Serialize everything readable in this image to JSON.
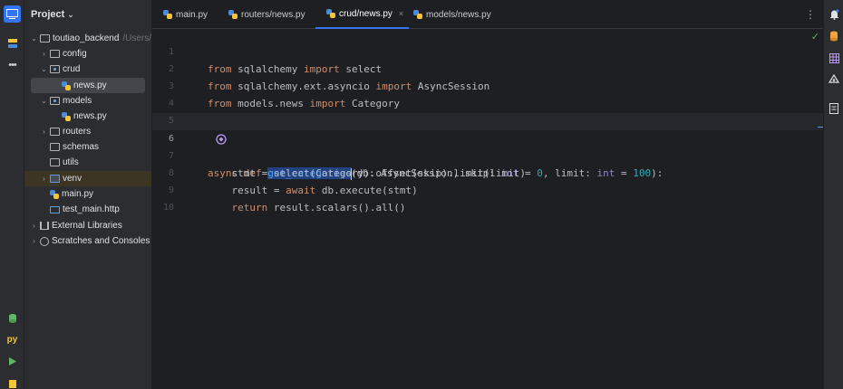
{
  "project_panel": {
    "title": "Project",
    "tree": [
      {
        "label": "toutiao_backend",
        "path": "/Users/d"
      },
      {
        "label": "config"
      },
      {
        "label": "crud"
      },
      {
        "label": "news.py"
      },
      {
        "label": "models"
      },
      {
        "label": "news.py"
      },
      {
        "label": "routers"
      },
      {
        "label": "schemas"
      },
      {
        "label": "utils"
      },
      {
        "label": "venv"
      },
      {
        "label": "main.py"
      },
      {
        "label": "test_main.http"
      },
      {
        "label": "External Libraries"
      },
      {
        "label": "Scratches and Consoles"
      }
    ]
  },
  "tabs": [
    {
      "label": "main.py"
    },
    {
      "label": "routers/news.py"
    },
    {
      "label": "crud/news.py",
      "close": "×"
    },
    {
      "label": "models/news.py"
    }
  ],
  "editor": {
    "line_numbers": [
      "1",
      "2",
      "3",
      "4",
      "5",
      "6",
      "7",
      "8",
      "9",
      "10"
    ],
    "code": {
      "l1": {
        "k1": "from",
        "t1": " sqlalchemy ",
        "k2": "import",
        "t2": " select"
      },
      "l2": {
        "k1": "from",
        "t1": " sqlalchemy.ext.asyncio ",
        "k2": "import",
        "t2": " AsyncSession"
      },
      "l3": {
        "k1": "from",
        "t1": " models.news ",
        "k2": "import",
        "t2": " Category"
      },
      "l6": {
        "k1": "async",
        "k2": " def ",
        "fn": "get_categories",
        "t1": "(db: AsyncSession, skip: ",
        "b1": "int",
        "t2": " = ",
        "n1": "0",
        "t3": ", limit: ",
        "b2": "int",
        "t4": " = ",
        "n2": "100",
        "t5": "):"
      },
      "l7": {
        "t1": "    stmt = select(Category).offset(skip).limit(limit)"
      },
      "l8": {
        "t1": "    result = ",
        "k1": "await",
        "t2": " db.execute(stmt)"
      },
      "l9": {
        "k1": "    return",
        "t1": " result.scalars().all()"
      }
    }
  },
  "icons": {
    "left_strip": [
      "project-view-icon",
      "structure-icon",
      "more-icon",
      "python-packages-icon",
      "python-console-icon",
      "run-icon",
      "problems-icon"
    ],
    "right_strip": [
      "notifications-icon",
      "database-icon",
      "sciview-icon",
      "ai-assistant-icon",
      "preview-icon"
    ]
  },
  "colors": {
    "accent": "#3574f0",
    "keyword": "#cf8e6d",
    "function": "#56a8f5",
    "number": "#2aacb8",
    "selection": "#214283"
  }
}
